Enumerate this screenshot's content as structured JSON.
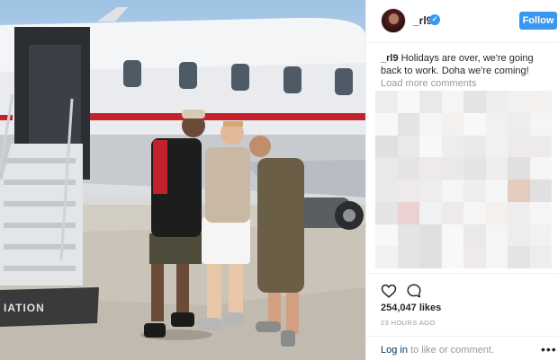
{
  "post": {
    "username": "_rl9",
    "follow_label": "Follow",
    "caption_user": "_rl9",
    "caption_text": " Holidays are over, we're going back to work. Doha we're coming!",
    "load_more_label": "Load more comments",
    "likes_count": "254,047 likes",
    "timestamp": "23 HOURS AGO",
    "login_link": "Log in",
    "login_suffix": " to like or comment.",
    "more_options_label": "•••"
  },
  "icons": {
    "verified": "verified-badge-icon",
    "like": "heart-icon",
    "comment": "comment-icon",
    "more": "more-options-icon"
  },
  "colors": {
    "accent": "#3897f0",
    "link": "#003569",
    "muted_text": "#999999",
    "border": "#efefef"
  }
}
